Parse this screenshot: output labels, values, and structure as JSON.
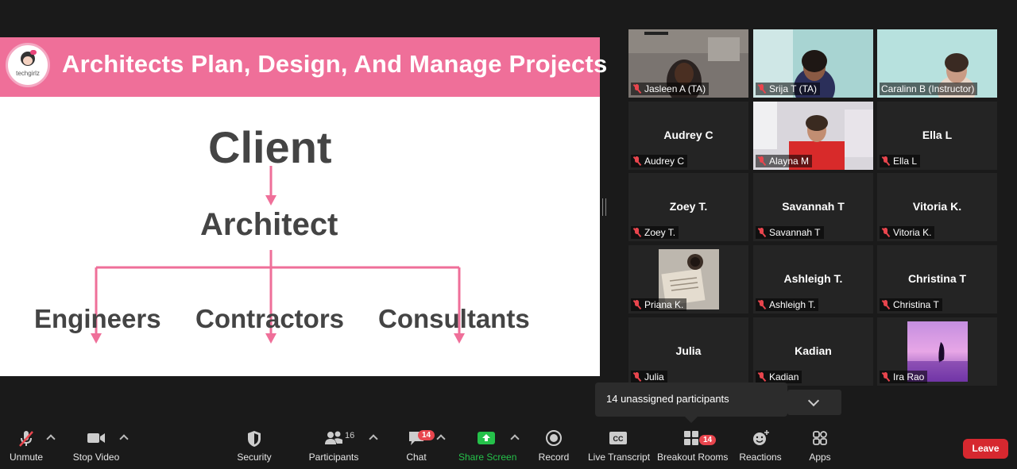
{
  "slide": {
    "title": "Architects Plan, Design, And Manage Projects",
    "logo_text": "techgirlz",
    "client": "Client",
    "architect": "Architect",
    "children": [
      "Engineers",
      "Contractors",
      "Consultants"
    ]
  },
  "gallery": {
    "tiles": [
      {
        "name": "Jasleen A (TA)",
        "big": ""
      },
      {
        "name": "Srija T (TA)",
        "big": ""
      },
      {
        "name": "Caralinn B (Instructor)",
        "big": ""
      },
      {
        "name": "Audrey C",
        "big": "Audrey C"
      },
      {
        "name": "Alayna M",
        "big": ""
      },
      {
        "name": "Ella L",
        "big": "Ella L"
      },
      {
        "name": "Zoey T.",
        "big": "Zoey T."
      },
      {
        "name": "Savannah T",
        "big": "Savannah T"
      },
      {
        "name": "Vitoria K.",
        "big": "Vitoria K."
      },
      {
        "name": "Priana K.",
        "big": ""
      },
      {
        "name": "Ashleigh T.",
        "big": "Ashleigh T."
      },
      {
        "name": "Christina T",
        "big": "Christina T"
      },
      {
        "name": "Julia",
        "big": "Julia"
      },
      {
        "name": "Kadian",
        "big": "Kadian"
      },
      {
        "name": "Ira Rao",
        "big": ""
      }
    ]
  },
  "popup": {
    "text": "14 unassigned participants"
  },
  "toolbar": {
    "unmute": "Unmute",
    "stop_video": "Stop Video",
    "security": "Security",
    "participants": "Participants",
    "participants_count": "16",
    "chat": "Chat",
    "chat_badge": "14",
    "share_screen": "Share Screen",
    "record": "Record",
    "live_transcript": "Live Transcript",
    "breakout_rooms": "Breakout Rooms",
    "breakout_badge": "14",
    "reactions": "Reactions",
    "apps": "Apps",
    "leave": "Leave",
    "cc_icon_text": "CC"
  },
  "colors": {
    "accent_pink": "#ef6f99",
    "active_speaker": "#c9e05a",
    "share_green": "#25c14a",
    "leave_red": "#d6282f"
  }
}
